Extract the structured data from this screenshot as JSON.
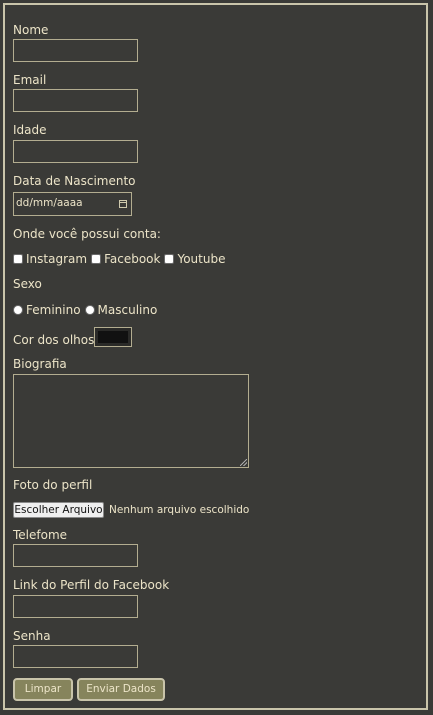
{
  "labels": {
    "nome": "Nome",
    "email": "Email",
    "idade": "Idade",
    "data_nascimento": "Data de Nascimento",
    "contas": "Onde você possui conta:",
    "sexo": "Sexo",
    "cor_olhos": "Cor dos olhos",
    "biografia": "Biografia",
    "foto": "Foto do perfil",
    "telefone": "Telefome",
    "facebook_link": "Link do Perfil do Facebook",
    "senha": "Senha"
  },
  "date_placeholder": "dd/mm/aaaa",
  "checkboxes": [
    "Instagram",
    "Facebook",
    "Youtube"
  ],
  "radios": [
    "Feminino",
    "Masculino"
  ],
  "eye_color": "#111111",
  "file": {
    "button_label": "Escolher Arquivo",
    "status": "Nenhum arquivo escolhido"
  },
  "buttons": {
    "clear": "Limpar",
    "submit": "Enviar Dados"
  },
  "colors": {
    "background": "#3a3a37",
    "text": "#ece4c8",
    "button": "#86845c",
    "border": "#c9c4aa"
  }
}
